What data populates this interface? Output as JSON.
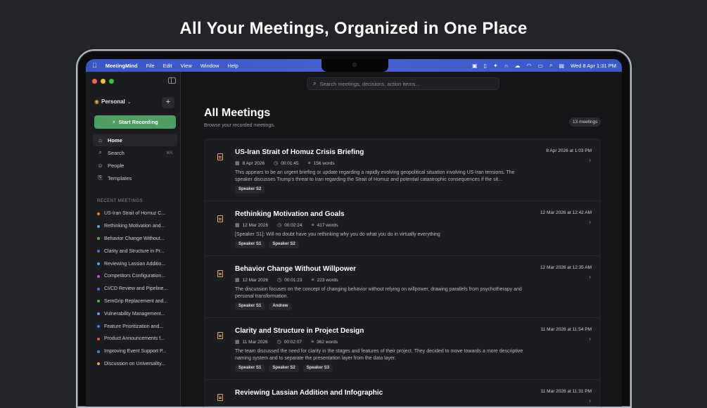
{
  "headline": "All Your Meetings, Organized in One Place",
  "menubar": {
    "app_name": "MeetingMind",
    "menus": [
      "File",
      "Edit",
      "View",
      "Window",
      "Help"
    ],
    "clock": "Wed 8 Apr  1:31 PM"
  },
  "sidebar": {
    "workspace": "Personal",
    "start_recording": "Start Recording",
    "nav": [
      {
        "label": "Home",
        "icon": "home-icon",
        "active": true
      },
      {
        "label": "Search",
        "icon": "search-icon",
        "shortcut": "⌘K"
      },
      {
        "label": "People",
        "icon": "people-icon"
      },
      {
        "label": "Templates",
        "icon": "templates-icon"
      }
    ],
    "recent_title": "RECENT MEETINGS",
    "recent": [
      {
        "label": "US-Iran Strait of Homuz C...",
        "color": "#e9823a"
      },
      {
        "label": "Rethinking Motivation and...",
        "color": "#3fb6d6"
      },
      {
        "label": "Behavior Change Without...",
        "color": "#4fb35f"
      },
      {
        "label": "Clarity and Structure in Pr...",
        "color": "#3f7fe0"
      },
      {
        "label": "Reviewing Lassian Additio...",
        "color": "#3fb6d6"
      },
      {
        "label": "Competitors Configuration...",
        "color": "#d03fd0"
      },
      {
        "label": "CI/CD Review and Pipeline...",
        "color": "#3f7fe0"
      },
      {
        "label": "SemGrip Replacement and...",
        "color": "#4fb35f"
      },
      {
        "label": "Vulnerability Management...",
        "color": "#3fb6d6"
      },
      {
        "label": "Feature Prioritization and...",
        "color": "#3f7fe0"
      },
      {
        "label": "Product Announcements f...",
        "color": "#e05050"
      },
      {
        "label": "Improving Event Support P...",
        "color": "#3f7fe0"
      },
      {
        "label": "Discussion on Universality...",
        "color": "#e9a94a"
      }
    ]
  },
  "search": {
    "placeholder": "Search meetings, decisions, action items..."
  },
  "main": {
    "title": "All Meetings",
    "subtitle": "Browse your recorded meetings.",
    "count": "13 meetings",
    "meetings": [
      {
        "title": "US-Iran Strait of Homuz Crisis Briefing",
        "timestamp": "8 Apr 2026 at 1:03 PM",
        "date": "8 Apr 2026",
        "duration": "00:01:45",
        "words": "156 words",
        "summary": "This appears to be an urgent briefing or update regarding a rapidly evolving geopolitical situation involving US-Iran tensions. The speaker discusses Trump's threat to Iran regarding the Strait of Homuz and potential catastrophic consequences if the sit...",
        "tags": [
          "Speaker S2"
        ]
      },
      {
        "title": "Rethinking Motivation and Goals",
        "timestamp": "12 Mar 2026 at 12:42 AM",
        "date": "12 Mar 2026",
        "duration": "00:02:24",
        "words": "417 words",
        "summary": "[Speaker S1]: Will no doubt have you rethinking why you do what you do in virtually everything",
        "tags": [
          "Speaker S1",
          "Speaker S2"
        ]
      },
      {
        "title": "Behavior Change Without Willpower",
        "timestamp": "12 Mar 2026 at 12:35 AM",
        "date": "12 Mar 2026",
        "duration": "00:01:23",
        "words": "223 words",
        "summary": "The discussion focuses on the concept of changing behavior without relying on willpower, drawing parallels from psychotherapy and personal transformation.",
        "tags": [
          "Speaker S1",
          "Andrew"
        ]
      },
      {
        "title": "Clarity and Structure in Project Design",
        "timestamp": "11 Mar 2026 at 11:54 PM",
        "date": "11 Mar 2026",
        "duration": "00:02:07",
        "words": "362 words",
        "summary": "The team discussed the need for clarity in the stages and features of their project. They decided to move towards a more descriptive naming system and to separate the presentation layer from the data layer.",
        "tags": [
          "Speaker S1",
          "Speaker S2",
          "Speaker S3"
        ]
      },
      {
        "title": "Reviewing Lassian Addition and Infographic",
        "timestamp": "11 Mar 2026 at 11:31 PM",
        "date": "",
        "duration": "",
        "words": "",
        "summary": "",
        "tags": []
      }
    ]
  }
}
